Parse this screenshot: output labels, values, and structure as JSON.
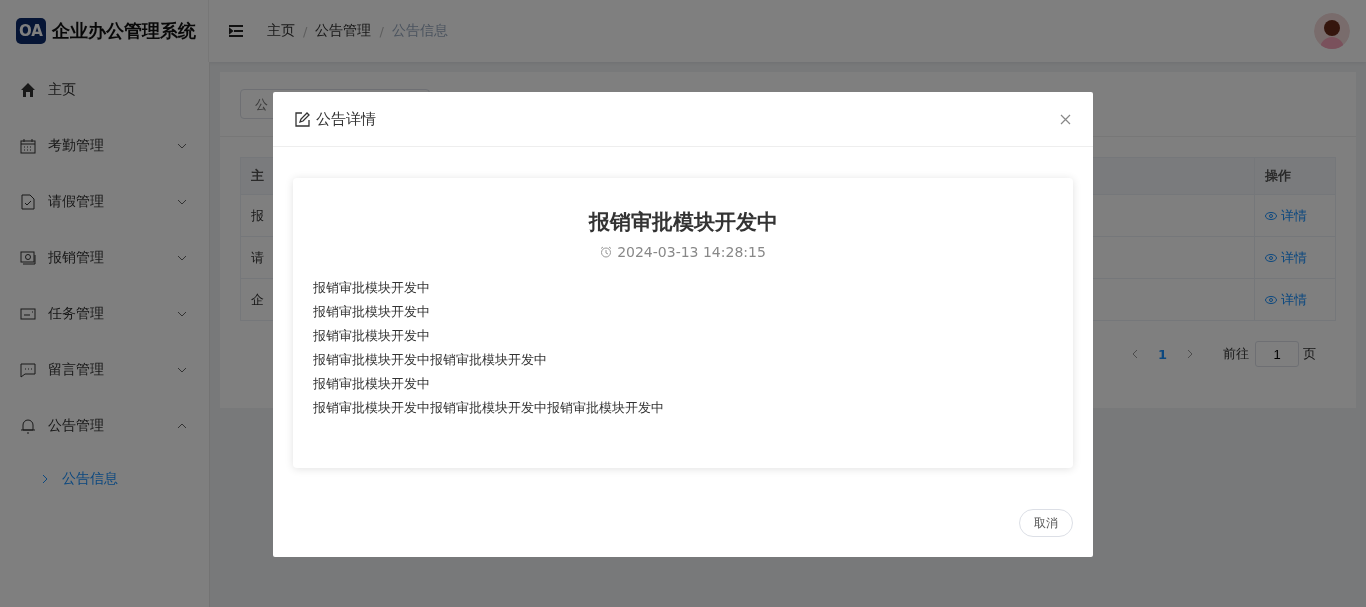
{
  "brand": {
    "logo": "OA",
    "title": "企业办公管理系统"
  },
  "breadcrumb": [
    {
      "label": "主页",
      "current": false
    },
    {
      "label": "公告管理",
      "current": false
    },
    {
      "label": "公告信息",
      "current": true
    }
  ],
  "breadcrumb_separators": [
    "/",
    "/"
  ],
  "sidebar": {
    "items": [
      {
        "label": "主页",
        "kind": "link"
      },
      {
        "label": "考勤管理",
        "kind": "group",
        "expanded": false
      },
      {
        "label": "请假管理",
        "kind": "group",
        "expanded": false
      },
      {
        "label": "报销管理",
        "kind": "group",
        "expanded": false
      },
      {
        "label": "任务管理",
        "kind": "group",
        "expanded": false
      },
      {
        "label": "留言管理",
        "kind": "group",
        "expanded": false
      },
      {
        "label": "公告管理",
        "kind": "group",
        "expanded": true,
        "children": [
          {
            "label": "公告信息",
            "selected": true
          }
        ]
      }
    ]
  },
  "search": {
    "placeholder": "公"
  },
  "table": {
    "columns": [
      "主",
      "操作"
    ],
    "rows": [
      {
        "column_1": "报",
        "action": "详情"
      },
      {
        "column_1": "请",
        "action": "详情"
      },
      {
        "column_1": "企",
        "action": "详情"
      }
    ]
  },
  "pagination": {
    "page": "1",
    "goto_label": "前往",
    "goto_value": "1",
    "suffix": "页"
  },
  "dialog": {
    "title": "公告详情",
    "notice": {
      "title": "报销审批模块开发中",
      "time": "2024-03-13 14:28:15",
      "lines": [
        "报销审批模块开发中",
        "报销审批模块开发中",
        "报销审批模块开发中",
        "报销审批模块开发中报销审批模块开发中",
        "报销审批模块开发中",
        "报销审批模块开发中报销审批模块开发中报销审批模块开发中"
      ]
    },
    "cancel": "取消"
  }
}
